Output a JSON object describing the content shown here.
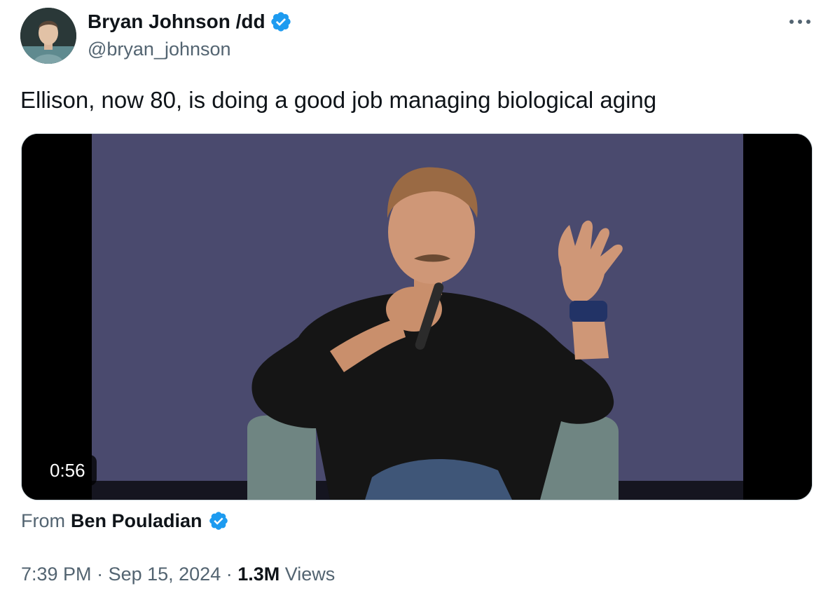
{
  "author": {
    "display_name": "Bryan Johnson /dd",
    "handle": "@bryan_johnson",
    "avatar_icon": "person-avatar",
    "verified": true
  },
  "tweet": {
    "text": "Ellison, now 80, is doing a good job managing biological aging"
  },
  "media": {
    "type": "video",
    "duration": "0:56"
  },
  "attribution": {
    "prefix": "From",
    "author": "Ben Pouladian",
    "verified": true
  },
  "meta": {
    "time": "7:39 PM",
    "separator": " · ",
    "date": "Sep 15, 2024",
    "views_count": "1.3M",
    "views_label": " Views"
  },
  "colors": {
    "verified_blue": "#1d9bf0",
    "secondary_text": "#536471",
    "primary_text": "#0f1419"
  },
  "icons": {
    "more": "more-horizontal-icon",
    "badge": "verified-badge-icon"
  }
}
